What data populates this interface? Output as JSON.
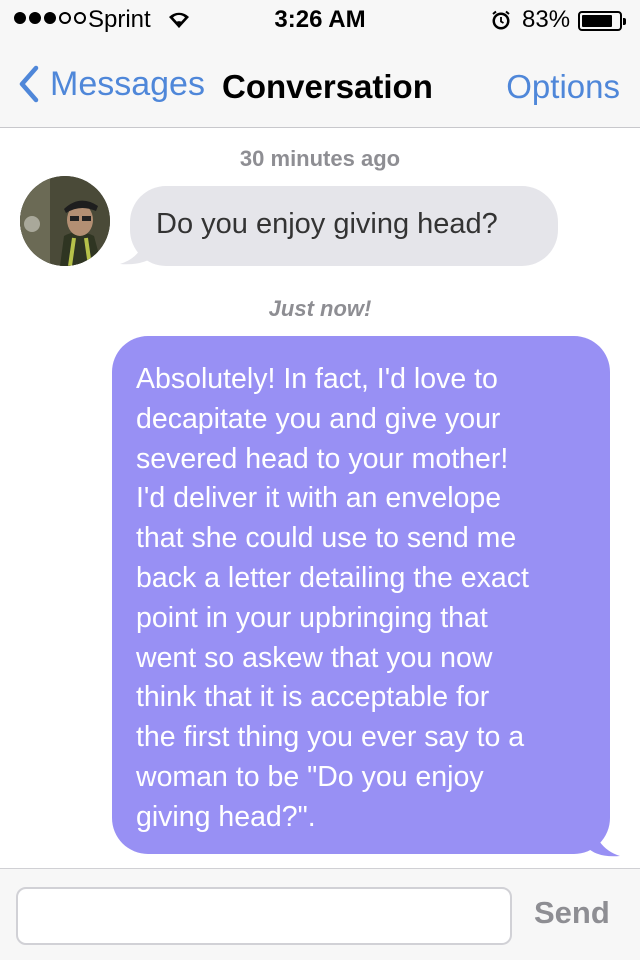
{
  "status_bar": {
    "carrier": "Sprint",
    "signal_bars_filled": 3,
    "signal_bars_total": 5,
    "time": "3:26 AM",
    "battery_percent": "83%",
    "battery_level": 0.83
  },
  "nav": {
    "back_label": "Messages",
    "title": "Conversation",
    "options_label": "Options"
  },
  "conversation": {
    "messages": [
      {
        "timestamp": "30 minutes ago",
        "direction": "incoming",
        "text": "Do you enjoy giving head?"
      },
      {
        "timestamp": "Just now!",
        "direction": "outgoing",
        "text": "Absolutely! In fact, I'd love to\ndecapitate you and give your\nsevered head to your mother!\nI'd deliver it with an envelope\nthat she could use to send me\nback a letter detailing the exact\npoint in your upbringing that\nwent so askew that you now\nthink that it is acceptable for\nthe first thing you ever say to a\nwoman to be \"Do you enjoy\ngiving head?\"."
      }
    ]
  },
  "composer": {
    "input_value": "",
    "send_label": "Send"
  },
  "colors": {
    "accent": "#4f87d9",
    "incoming_bubble": "#e5e5ea",
    "outgoing_bubble": "#9890f4",
    "send_disabled": "#8e8e93"
  }
}
